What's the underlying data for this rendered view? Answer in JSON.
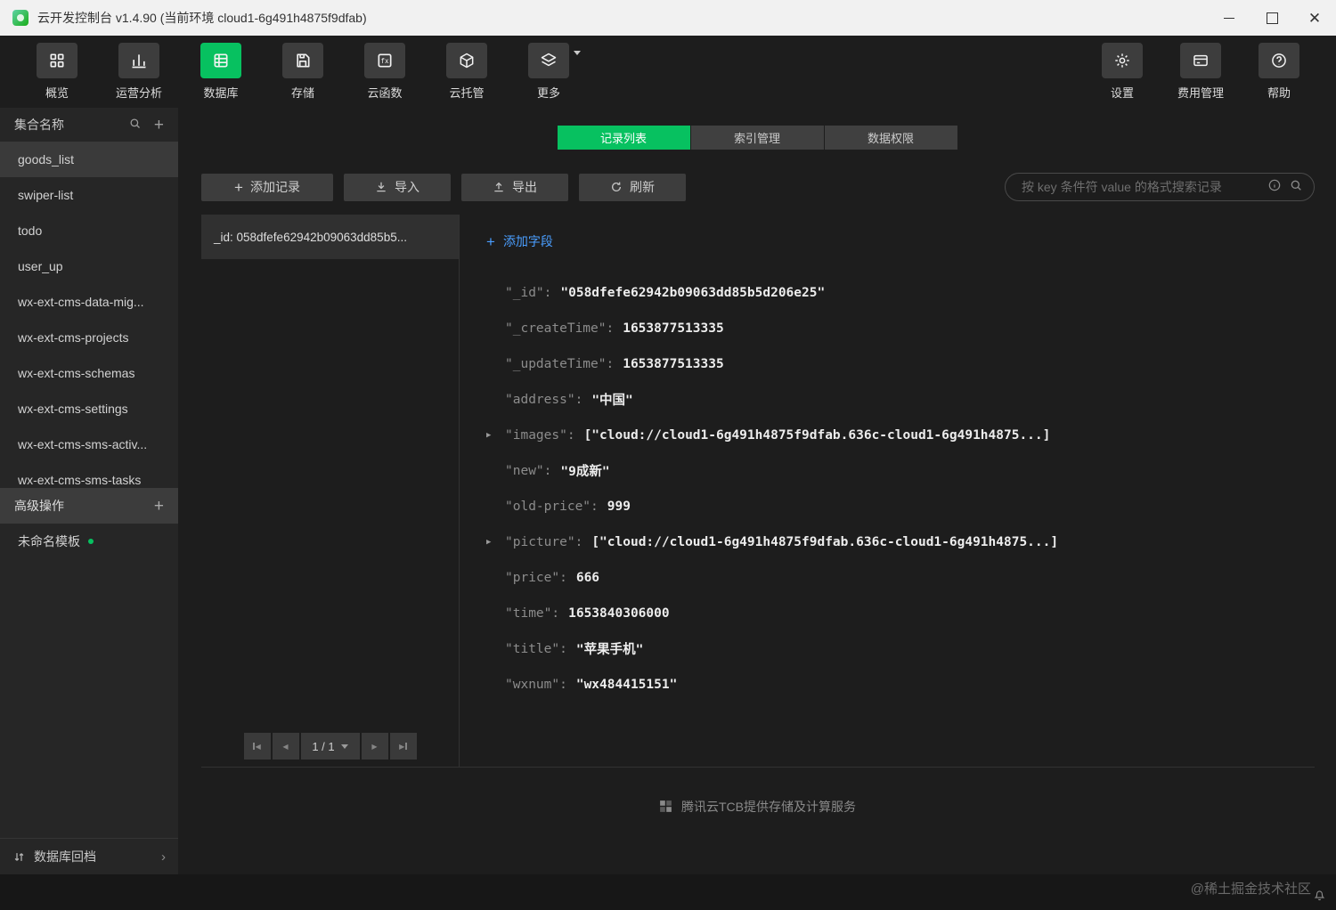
{
  "titlebar": {
    "title": "云开发控制台 v1.4.90 (当前环境 cloud1-6g491h4875f9dfab)"
  },
  "colors": {
    "accent_green": "#07c160",
    "link_blue": "#4a9eff"
  },
  "toolbar": {
    "items": [
      {
        "label": "概览",
        "icon": "grid-icon"
      },
      {
        "label": "运营分析",
        "icon": "bar-chart-icon"
      },
      {
        "label": "数据库",
        "icon": "database-icon",
        "active": true
      },
      {
        "label": "存储",
        "icon": "save-icon"
      },
      {
        "label": "云函数",
        "icon": "function-icon"
      },
      {
        "label": "云托管",
        "icon": "cube-icon"
      },
      {
        "label": "更多",
        "icon": "layers-icon"
      }
    ],
    "right_items": [
      {
        "label": "设置",
        "icon": "gear-icon"
      },
      {
        "label": "费用管理",
        "icon": "billing-icon"
      },
      {
        "label": "帮助",
        "icon": "help-icon"
      }
    ]
  },
  "sidebar": {
    "header": "集合名称",
    "collections": [
      "goods_list",
      "swiper-list",
      "todo",
      "user_up",
      "wx-ext-cms-data-mig...",
      "wx-ext-cms-projects",
      "wx-ext-cms-schemas",
      "wx-ext-cms-settings",
      "wx-ext-cms-sms-activ...",
      "wx-ext-cms-sms-tasks"
    ],
    "active_collection": "goods_list",
    "advanced_header": "高级操作",
    "template_item": "未命名模板",
    "rollback": "数据库回档"
  },
  "tabs": [
    {
      "label": "记录列表",
      "active": true
    },
    {
      "label": "索引管理",
      "active": false
    },
    {
      "label": "数据权限",
      "active": false
    }
  ],
  "actions": {
    "add_record": "添加记录",
    "import": "导入",
    "export": "导出",
    "refresh": "刷新"
  },
  "search": {
    "placeholder": "按 key 条件符 value 的格式搜索记录"
  },
  "record_list": {
    "selected": "_id: 058dfefe62942b09063dd85b5...",
    "page_label": "1 / 1"
  },
  "doc": {
    "add_field": "添加字段",
    "fields": [
      {
        "arrow": "",
        "k": "\"_id\":",
        "v": "\"058dfefe62942b09063dd85b5d206e25\""
      },
      {
        "arrow": "",
        "k": "\"_createTime\":",
        "v": "1653877513335"
      },
      {
        "arrow": "",
        "k": "\"_updateTime\":",
        "v": "1653877513335"
      },
      {
        "arrow": "",
        "k": "\"address\":",
        "v": "\"中国\""
      },
      {
        "arrow": "▶",
        "k": "\"images\":",
        "v": "[\"cloud://cloud1-6g491h4875f9dfab.636c-cloud1-6g491h4875...]"
      },
      {
        "arrow": "",
        "k": "\"new\":",
        "v": "\"9成新\""
      },
      {
        "arrow": "",
        "k": "\"old-price\":",
        "v": "999"
      },
      {
        "arrow": "▶",
        "k": "\"picture\":",
        "v": "[\"cloud://cloud1-6g491h4875f9dfab.636c-cloud1-6g491h4875...]"
      },
      {
        "arrow": "",
        "k": "\"price\":",
        "v": "666"
      },
      {
        "arrow": "",
        "k": "\"time\":",
        "v": "1653840306000"
      },
      {
        "arrow": "",
        "k": "\"title\":",
        "v": "\"苹果手机\""
      },
      {
        "arrow": "",
        "k": "\"wxnum\":",
        "v": "\"wx484415151\""
      }
    ]
  },
  "footer": {
    "text": "腾讯云TCB提供存储及计算服务"
  },
  "watermark": {
    "text": "@稀土掘金技术社区"
  }
}
